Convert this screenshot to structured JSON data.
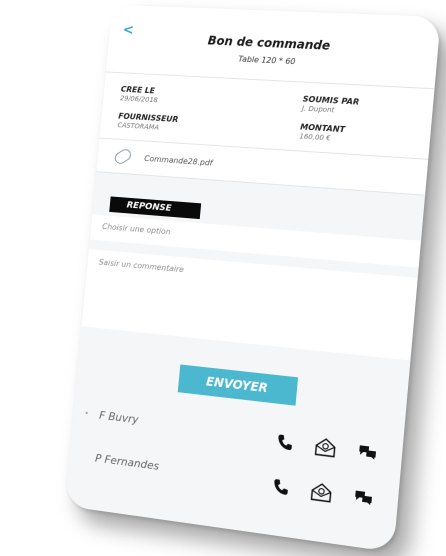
{
  "header": {
    "back_label": "<",
    "title": "Bon de commande",
    "subtitle": "Table 120 * 60"
  },
  "info": {
    "created_label": "CREE LE",
    "created_value": "29/06/2018",
    "submitted_label": "SOUMIS PAR",
    "submitted_value": "J. Dupont",
    "supplier_label": "FOURNISSEUR",
    "supplier_value": "CASTORAMA",
    "amount_label": "MONTANT",
    "amount_value": "160,00 €"
  },
  "attachment": {
    "file_name": "Commande28.pdf",
    "icon": "paperclip-icon"
  },
  "response": {
    "label": "REPONSE",
    "select_placeholder": "Choisir une option",
    "comment_placeholder": "Saisir un commentaire"
  },
  "send_button": {
    "label": "ENVOYER",
    "color": "#4bb8cf"
  },
  "contacts": [
    {
      "name": "F Buvry",
      "bullet": "•"
    },
    {
      "name": "P Fernandes",
      "bullet": ""
    }
  ],
  "contact_icons": [
    "phone-icon",
    "mail-icon",
    "chat-icon"
  ],
  "colors": {
    "accent": "#4bb8cf",
    "back": "#37a3c6",
    "label_bg": "#0a0a0a"
  }
}
